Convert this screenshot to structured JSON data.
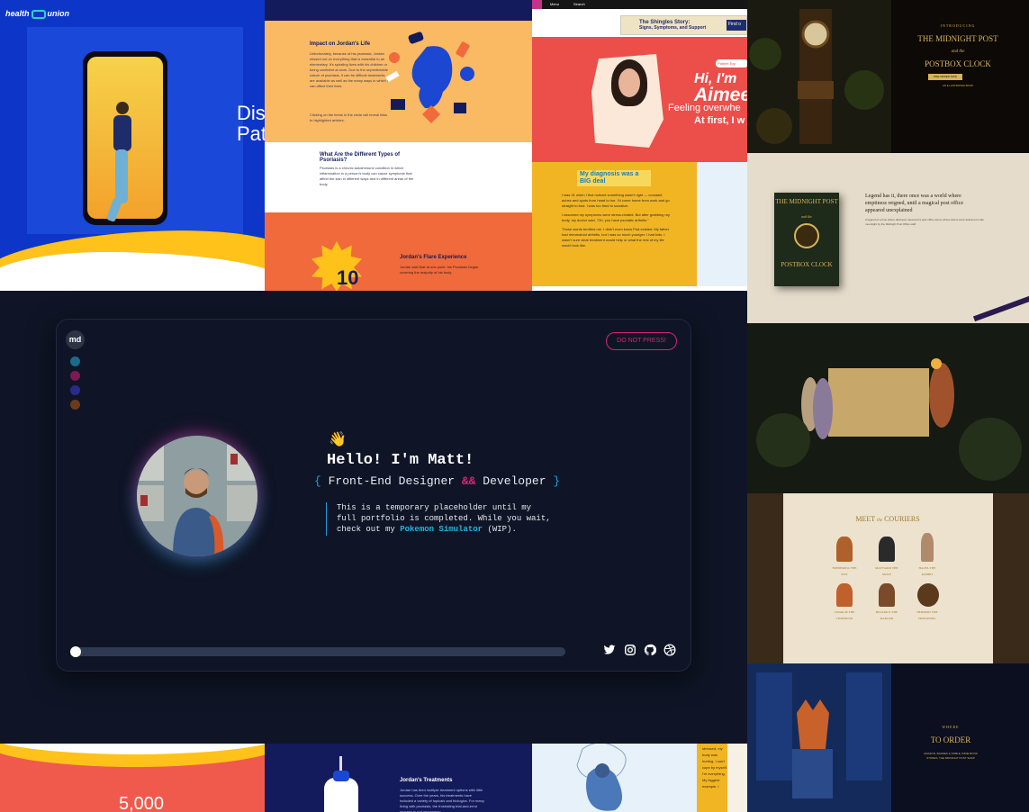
{
  "tiles": {
    "health": {
      "logo_left": "health",
      "logo_right": "union",
      "heading_line1": "Disc",
      "heading_line2": "Pat"
    },
    "jordan": {
      "impact_title": "Impact on Jordan's Life",
      "impact_text": "Unfortunately, because of his psoriasis, Jordan missed out on everything that is essential to an elementary. It's spiraling lives with his children or being confident at work. Due to the unpredictable nature of psoriasis, it can be difficult treatments are available as well as the many ways in which it can affect their lives.",
      "impact_text2": "Clicking on the items in the circle will reveal links to highlighted articles.",
      "types_title": "What Are the Different Types of Psoriasis?",
      "types_text": "Psoriasis is a chronic autoimmune condition in which inflammation in a person's body can cause symptoms that affect the skin in different ways and in different areas of the body.",
      "flare_title": "Jordan's Flare Experience",
      "flare_text": "Jordan said that at one point, his Psoriasis began covering the majority of his body.",
      "flare_number": "10"
    },
    "shingles": {
      "nav_menu": "Menu",
      "nav_search": "Search",
      "banner_title": "The Shingles Story:",
      "banner_sub": "Signs, Symptoms, and Support",
      "banner_cta": "Find o",
      "patient_pill": "Patient Exp",
      "hi": "Hi, I'm",
      "name": "Aimee",
      "feeling": "Feeling overwhe",
      "first": "At first, I w",
      "diagnosis_title": "My diagnosis was a BIG deal",
      "diagnosis_text1": "I was 21 when I first noticed something wasn't right — constant aches and spots from head to toe. I'd come home from work and go straight to bed. I was too tired to socialize.",
      "diagnosis_text2": "I assumed my symptoms were stress-related. But after grabbing my body, my doctor said, \"Oh, you have psoriatic arthritis.\"",
      "diagnosis_text3": "Those words terrified me. I didn't even know PsA existed. My father had rheumatoid arthritis, but I was so much younger. I had kids. I wasn't sure what treatment would help or what the rest of my life would look like."
    },
    "midnight": {
      "introducing": "INTRODUCING",
      "title1": "THE MIDNIGHT POST",
      "title_and": "and the",
      "title2": "POSTBOX CLOCK",
      "cta": "PRE-ORDER NOW",
      "byline": "AN ILLUSTRATED BOOK",
      "book_top": "THE MIDNIGHT POST",
      "book_and": "and the",
      "book_bottom": "POSTBOX CLOCK",
      "legend": "Legend has it, there once was a world where emptiness reigned, until a magical post office appeared unexplained",
      "legend_body": "A legend of a time where darkness ruled and a post office stood, where letters were delivered under moonlight by the Midnight Post Office staff.",
      "meet": "MEET",
      "the": "the",
      "couriers": "COURIERS",
      "courier_names": [
        "FREDERICK THE FOX",
        "MAYNARD THE MOLE",
        "HAZEL THE RABBIT",
        "CHARLIE THE CHIPMUNK",
        "BEATRICE THE BADGER",
        "HERBERT THE HEDGEHOG"
      ],
      "where": "WHERE",
      "to_order": "TO ORDER",
      "order_lines": "AMAZON, BARNES & NOBLE, INDIE BOOK STORES, THE MIDNIGHT POST SHOP"
    },
    "bottom": {
      "stat": "5,000",
      "treatments_title": "Jordan's Treatments",
      "treatments_text": "Jordan has tried multiple treatment options with little success. Over the years, his treatments have included a variety of topicals and biologics. For many living with psoriasis, the frustrating trial-and-error process is not uncommon.",
      "side_text": "stressed, my body was hurting. I can't cope by myself. I'm everything. My biggest example, I"
    }
  },
  "card": {
    "logo": "md",
    "dots": [
      {
        "color": "#1b6a8a"
      },
      {
        "color": "#7a1a52"
      },
      {
        "color": "#2a2a8c"
      },
      {
        "color": "#6a3a1a"
      }
    ],
    "dont_press": "DO NOT PRESS!",
    "wave_emoji": "👋",
    "hello": "Hello! I'm Matt!",
    "sub_open": "{",
    "sub_text1": "Front-End Designer",
    "sub_amp": "&&",
    "sub_text2": "Developer",
    "sub_close": "}",
    "bio_pre": "This is a temporary placeholder until my full portfolio is completed. While you wait, check out my",
    "bio_link": "Pokemon Simulator",
    "bio_post": "(WIP).",
    "progress": 0,
    "social": [
      {
        "icon": "twitter-icon",
        "glyph": "🐦"
      },
      {
        "icon": "instagram-icon",
        "glyph": "◎"
      },
      {
        "icon": "github-icon",
        "glyph": "◉"
      },
      {
        "icon": "dribbble-icon",
        "glyph": "⊕"
      }
    ]
  }
}
